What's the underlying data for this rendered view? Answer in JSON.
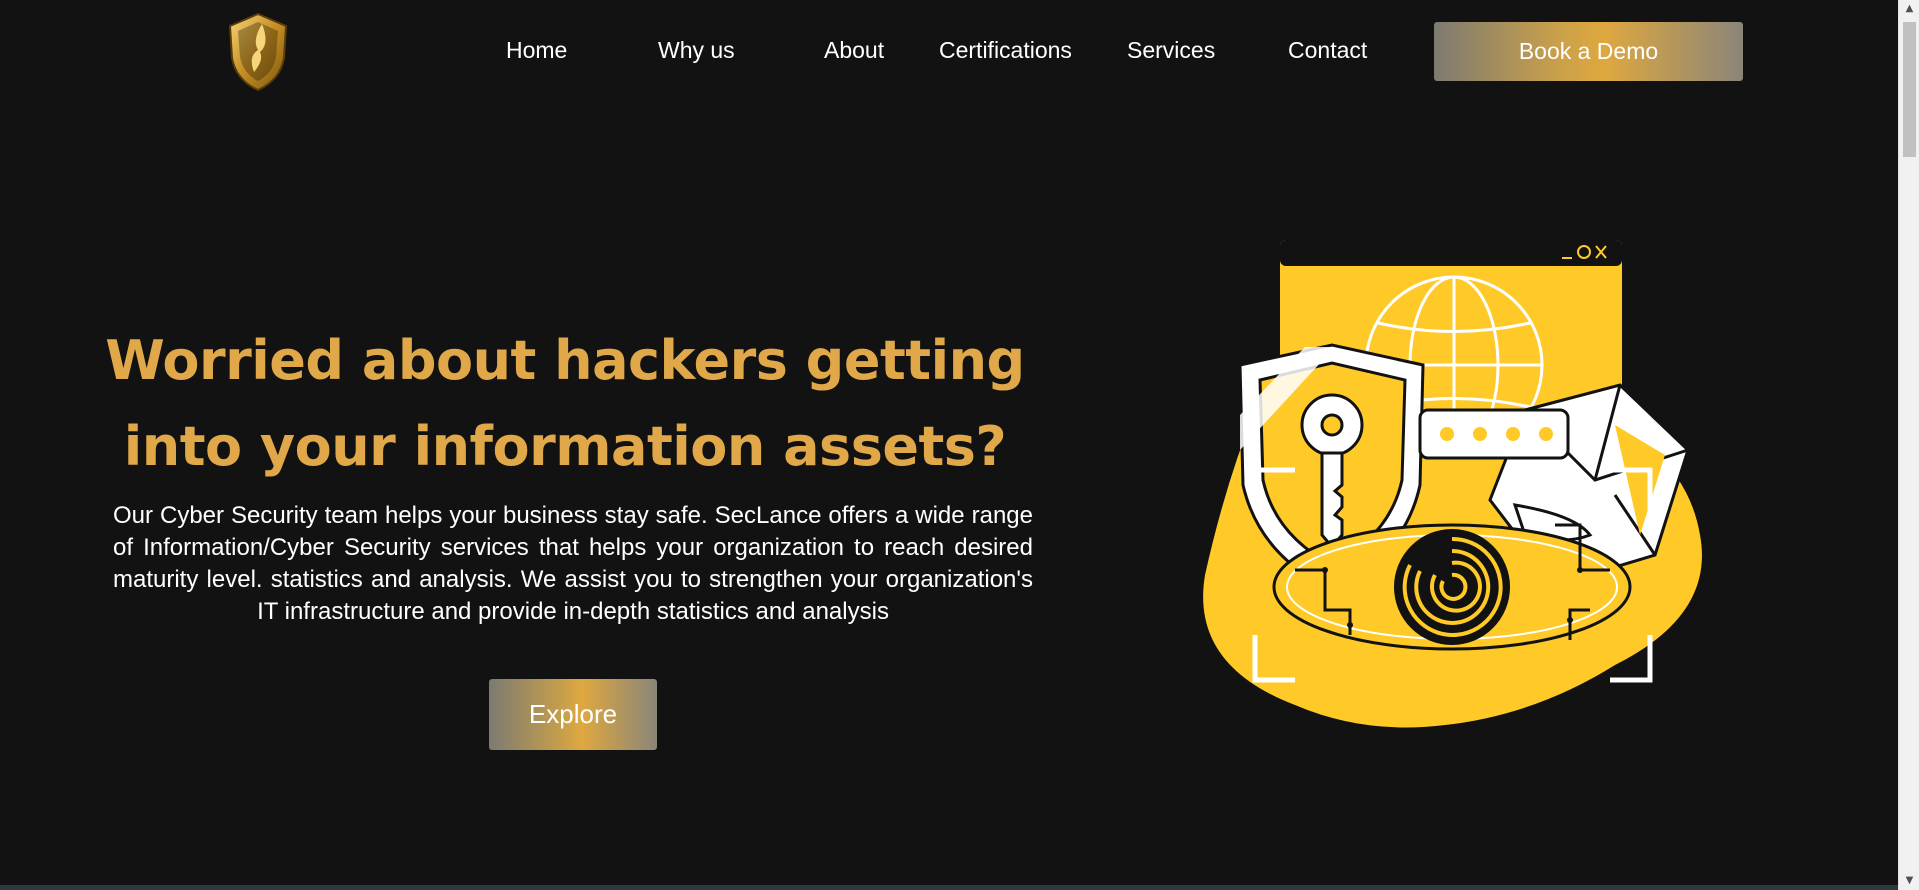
{
  "nav": {
    "links": [
      "Home",
      "Why us",
      "About",
      "Certifications",
      "Services",
      "Contact"
    ],
    "cta_label": "Book a Demo",
    "logo_icon": "shield-logo-icon"
  },
  "hero": {
    "title_line1": "Worried about hackers getting",
    "title_line2": "into your information assets?",
    "description": "Our Cyber Security team helps your business stay safe. SecLance offers a wide range of Information/Cyber Security services that helps your organization to reach desired maturity level. statistics and analysis. We assist you to strengthen your organization's IT infrastructure and provide in-depth statistics and analysis",
    "explore_label": "Explore",
    "illustration_icons": [
      "globe-icon",
      "shield-icon",
      "key-icon",
      "password-field-icon",
      "envelope-icon",
      "fingerprint-eye-icon",
      "window-controls-icon"
    ]
  },
  "scrollbar": {
    "up_icon": "scroll-up-arrow-icon",
    "down_icon": "scroll-down-arrow-icon"
  },
  "colors": {
    "background": "#121212",
    "accent_gold": "#e0a848",
    "illustration_yellow": "#ffc928"
  }
}
